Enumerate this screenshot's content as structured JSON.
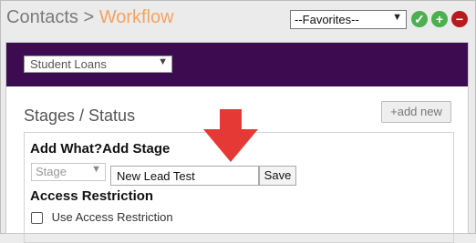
{
  "header": {
    "root": "Contacts",
    "separator": ">",
    "current": "Workflow"
  },
  "favorites": {
    "selected": "--Favorites--"
  },
  "actions": {
    "ok_icon": "check-icon",
    "add_icon": "plus-icon",
    "remove_icon": "minus-icon"
  },
  "program_select": {
    "selected": "Student Loans"
  },
  "section": {
    "title": "Stages / Status",
    "add_new": "+add new"
  },
  "form": {
    "add_what": "Add What?",
    "add_stage": "Add Stage",
    "type_select": "Stage",
    "stage_name": "New Lead Test",
    "save": "Save",
    "access_title": "Access Restriction",
    "use_access_label": "Use Access Restriction"
  },
  "colors": {
    "purple_bar": "#3d0b4f",
    "green": "#4caf50",
    "red_remove": "#b71c1c",
    "arrow": "#e53935",
    "header_accent": "#f4a261"
  }
}
